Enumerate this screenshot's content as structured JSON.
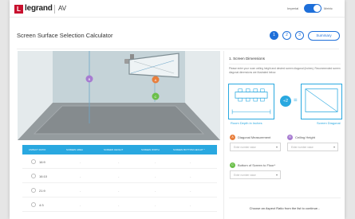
{
  "header": {
    "logo_letter": "L",
    "brand": "legrand",
    "sub": "AV",
    "unit_left": "Imperial",
    "unit_right": "Metric",
    "accent": "#c8102e"
  },
  "page": {
    "title": "Screen Surface Selection Calculator",
    "steps": [
      "1",
      "2",
      "3"
    ],
    "summary_label": "Summary",
    "accent": "#1e6fd9"
  },
  "room": {
    "markers": [
      {
        "letter": "A",
        "color": "#e87e3c"
      },
      {
        "letter": "B",
        "color": "#a77bd1"
      },
      {
        "letter": "C",
        "color": "#6bbf4a"
      }
    ]
  },
  "table": {
    "headers": [
      "ASPECT RATIO",
      "SCREEN AREA",
      "SCREEN HEIGHT",
      "SCREEN WIDTH",
      "SCREEN BOTTOM HEIGHT *"
    ],
    "rows": [
      {
        "ratio": "16:9",
        "cells": [
          "-",
          "-",
          "-",
          "-"
        ]
      },
      {
        "ratio": "16:10",
        "cells": [
          "-",
          "-",
          "-",
          "-"
        ]
      },
      {
        "ratio": "21:9",
        "cells": [
          "-",
          "-",
          "-",
          "-"
        ]
      },
      {
        "ratio": "4:3",
        "cells": [
          "-",
          "-",
          "-",
          "-"
        ]
      }
    ],
    "accent": "#29a8e0"
  },
  "panel": {
    "section_title": "1. Screen Dimensions",
    "instructions": "Please enter your room ceiling height and desired screen diagonal (inches). Recommended screen diagonal dimensions are illustrated below.",
    "depth_label": "Room Depth in Inches",
    "multiplier": "÷2",
    "equals": "=",
    "diagonal_label": "Screen Diagonal",
    "fields": {
      "diagonal": {
        "marker": "A",
        "label": "Diagonal Measurement",
        "placeholder": "Enter number value"
      },
      "ceiling": {
        "marker": "B",
        "label": "Ceiling Height",
        "placeholder": "Enter number value"
      },
      "bottom": {
        "marker": "C",
        "label": "Bottom of Screen to Floor*",
        "placeholder": "Enter number value"
      }
    },
    "footer": "Choose an Aspect Ratio from the list to continue..."
  }
}
